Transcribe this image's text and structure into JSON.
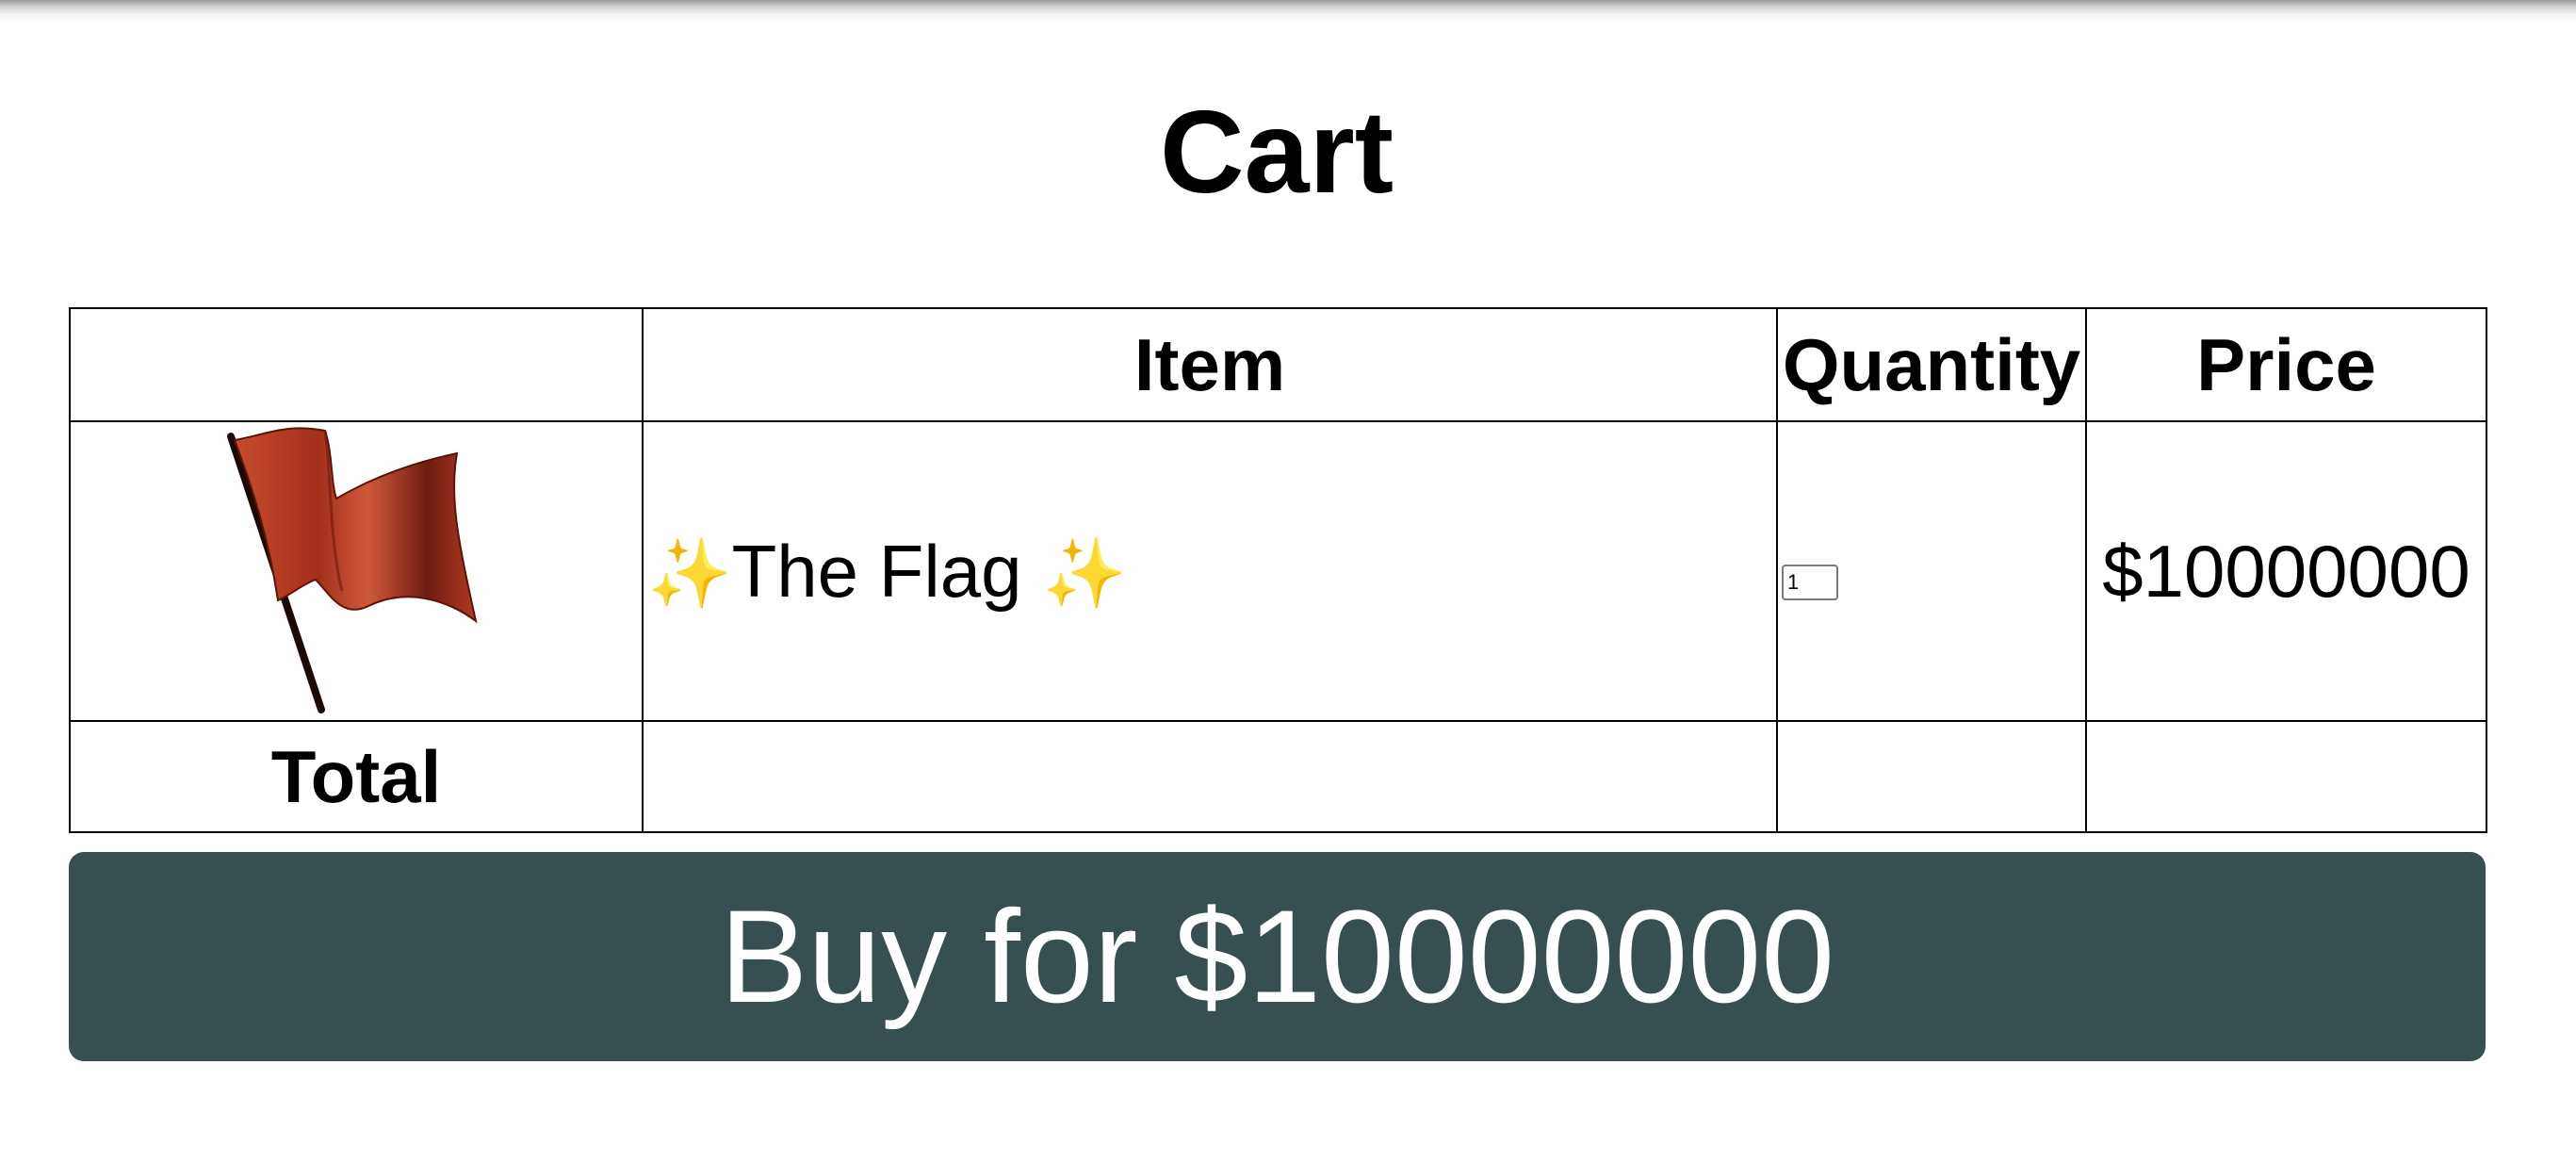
{
  "page": {
    "title": "Cart"
  },
  "table": {
    "headers": {
      "image": "",
      "item": "Item",
      "quantity": "Quantity",
      "price": "Price"
    },
    "rows": [
      {
        "image_icon": "red-flag-icon",
        "sparkle_left": "✨",
        "item_name": "The Flag",
        "sparkle_right": "✨",
        "quantity": "1",
        "price": "$10000000"
      }
    ],
    "total_label": "Total"
  },
  "buy": {
    "label": "Buy for $10000000"
  },
  "colors": {
    "button_bg": "#374f51",
    "button_text": "#ffffff",
    "flag_red": "#a3301c",
    "sparkle": "#f2c23b"
  }
}
